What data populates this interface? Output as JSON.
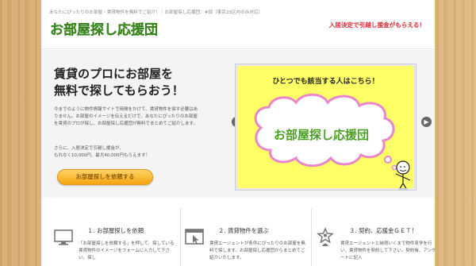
{
  "header": {
    "tagline": "あなたにぴったりのお部屋・賃貸物件を無料でご紹介！｜お部屋探し応援団：#部（東京23区内のみ対応）",
    "logo_text": "お部屋探し応援団",
    "banner": "入居決定で引越し援金がもらえる！"
  },
  "hero": {
    "title_line1": "賃貸のプロにお部屋を",
    "title_line2": "無料で探してもらおう！",
    "desc1": "今までのように物件情報サイトで時間をかけて、賃貸物件を探す必要はありません。お部屋のイメージを伝えるだけで、あなたにぴったりのお部屋を賃貸のプロが探し、お部屋探し応援団が無料でまとめてご紹介します。",
    "desc2_line1": "さらに、入居決定で引越し援金が、",
    "desc2_line2": "もれなく10,000円、最大40,000円もらえます！",
    "cta_label": "お部屋探しを依頼する"
  },
  "slider": {
    "headline": "ひとつでも該当する人はこちら！",
    "cloud_text": "お部屋探し応援団",
    "prev_icon": "chevron-left-icon",
    "next_icon": "chevron-right-icon",
    "bg_color": "#ffff66"
  },
  "features": [
    {
      "title": "１. お部屋探しを依頼",
      "icon": "monitor-icon",
      "desc": "「お部屋探しを依頼する」を押して、探している賃貸物件のイメージをフォームに入力して下さい。探し"
    },
    {
      "title": "２. 賃貸物件を選ぶ",
      "icon": "browser-cursor-icon",
      "desc": "賃貸エージェントが条件にぴったりのお部屋を無料で探します。お部屋探し応援団からまとめてご紹介いたします。"
    },
    {
      "title": "３. 契約、応援金ＧＥＴ！",
      "icon": "star-person-icon",
      "desc": "賃貸エージェントと納得いくまで物件見学を行い、賃貸物件を契約して下さい。契約後、アンケートに記入"
    }
  ]
}
